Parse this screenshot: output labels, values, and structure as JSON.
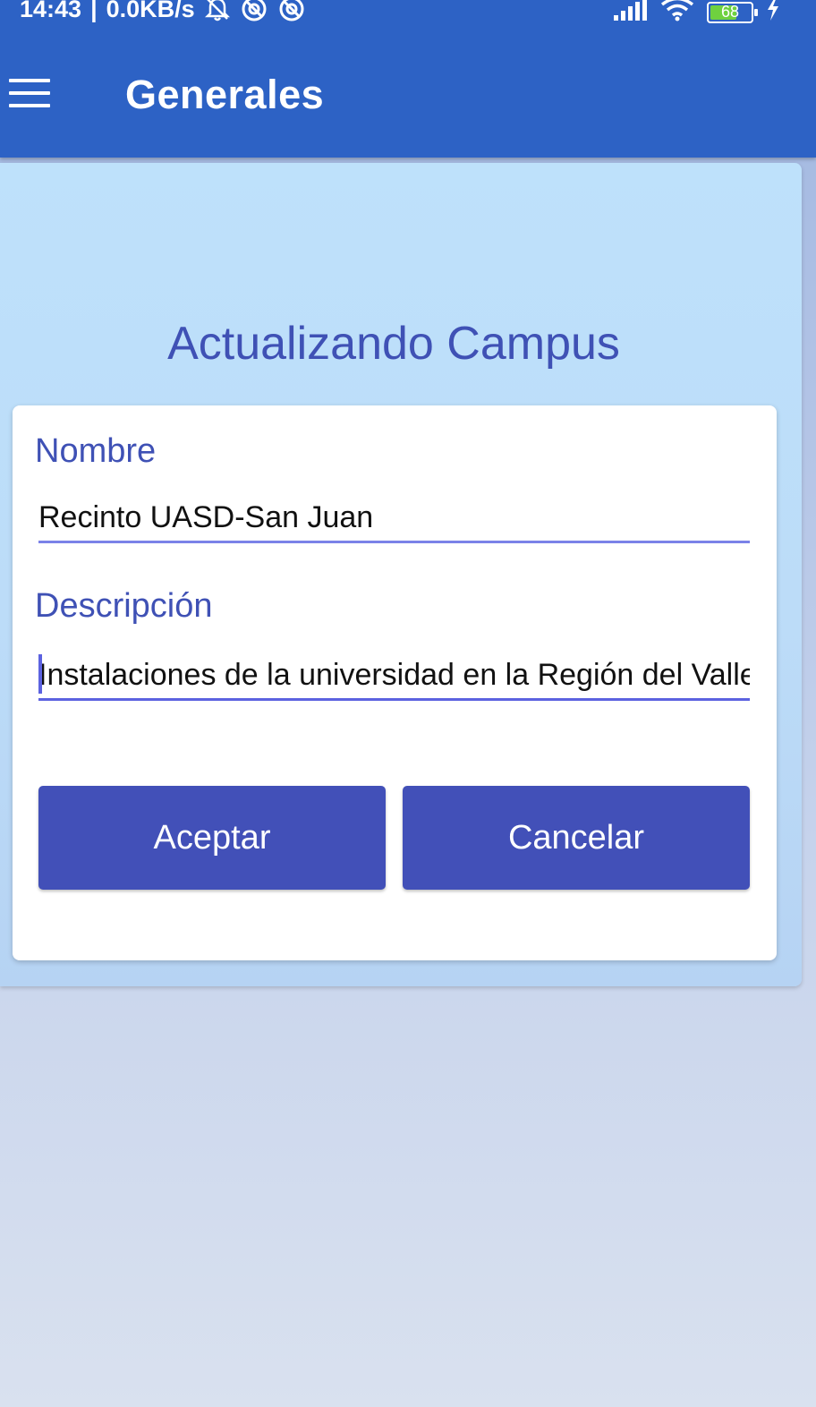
{
  "status_bar": {
    "time": "14:43",
    "network_speed": "0.0KB/s",
    "left_icons": [
      "alarm-off-icon",
      "sync-icon",
      "sync-icon"
    ],
    "right_icons": [
      "signal-icon",
      "wifi-icon",
      "battery-icon",
      "charging-icon"
    ],
    "battery_level": "68"
  },
  "toolbar": {
    "menu_icon": "hamburger-menu-icon",
    "title": "Generales"
  },
  "form": {
    "heading": "Actualizando Campus",
    "nombre": {
      "label": "Nombre",
      "value": "Recinto UASD-San Juan"
    },
    "descripcion": {
      "label": "Descripción",
      "value": "Instalaciones de la universidad en la Región del Valle, l"
    },
    "accept_label": "Aceptar",
    "cancel_label": "Cancelar"
  },
  "colors": {
    "app_bar": "#2d62c5",
    "accent": "#3f51b5",
    "button": "#4250b8",
    "underline": "#7b82e8",
    "panel": "#bee1fb",
    "battery_fill": "#6fd13f"
  }
}
